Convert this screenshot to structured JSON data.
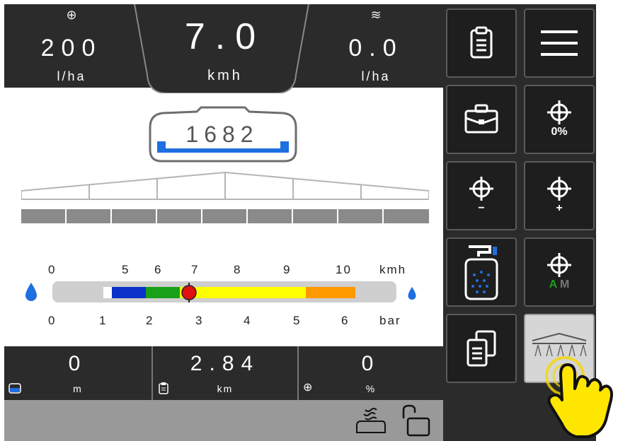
{
  "top_bar": {
    "target_rate": {
      "icon": "target-icon",
      "value": "200",
      "unit": "l/ha"
    },
    "speed": {
      "value": "7.0",
      "unit": "kmh"
    },
    "actual_rate": {
      "icon": "flow-icon",
      "value": "0.0",
      "unit": "l/ha"
    }
  },
  "tank": {
    "value": "1682",
    "level_color": "#1e6fe0"
  },
  "boom": {
    "section_count": 9
  },
  "gauge": {
    "speed_ticks": [
      "0",
      "5",
      "6",
      "7",
      "8",
      "9",
      "10",
      "kmh"
    ],
    "pressure_ticks": [
      "0",
      "1",
      "2",
      "3",
      "4",
      "5",
      "6",
      "bar"
    ],
    "colors": {
      "blue": "#0a32c8",
      "green": "#19a019",
      "yellow": "#ffff00",
      "orange": "#ff9900",
      "marker": "#e01010"
    }
  },
  "bottom_bar": {
    "distance": {
      "icon": "tank-icon",
      "value": "0",
      "unit": "m"
    },
    "km": {
      "icon": "clipboard-icon",
      "value": "2.84",
      "unit": "km"
    },
    "percent": {
      "icon": "target-icon",
      "value": "0",
      "unit": "%"
    }
  },
  "status_bar": {
    "icons": [
      "spray-icon",
      "unlock-icon"
    ]
  },
  "side_buttons": [
    {
      "name": "clipboard-button",
      "icon": "clipboard-icon",
      "sub": ""
    },
    {
      "name": "menu-button",
      "icon": "hamburger-icon",
      "sub": ""
    },
    {
      "name": "briefcase-button",
      "icon": "briefcase-icon",
      "sub": ""
    },
    {
      "name": "rate-percent-button",
      "icon": "target-icon",
      "sub": "0%"
    },
    {
      "name": "rate-decrease-button",
      "icon": "target-icon",
      "sub": "−"
    },
    {
      "name": "rate-increase-button",
      "icon": "target-icon",
      "sub": "+"
    },
    {
      "name": "fill-tank-button",
      "icon": "fill-tank-icon",
      "sub": ""
    },
    {
      "name": "auto-manual-button",
      "icon": "target-icon",
      "sub_a": "A",
      "sub_m": "M"
    },
    {
      "name": "copy-button",
      "icon": "copy-icon",
      "sub": ""
    },
    {
      "name": "boom-spray-button",
      "icon": "boom-spray-icon",
      "sub": ""
    }
  ]
}
